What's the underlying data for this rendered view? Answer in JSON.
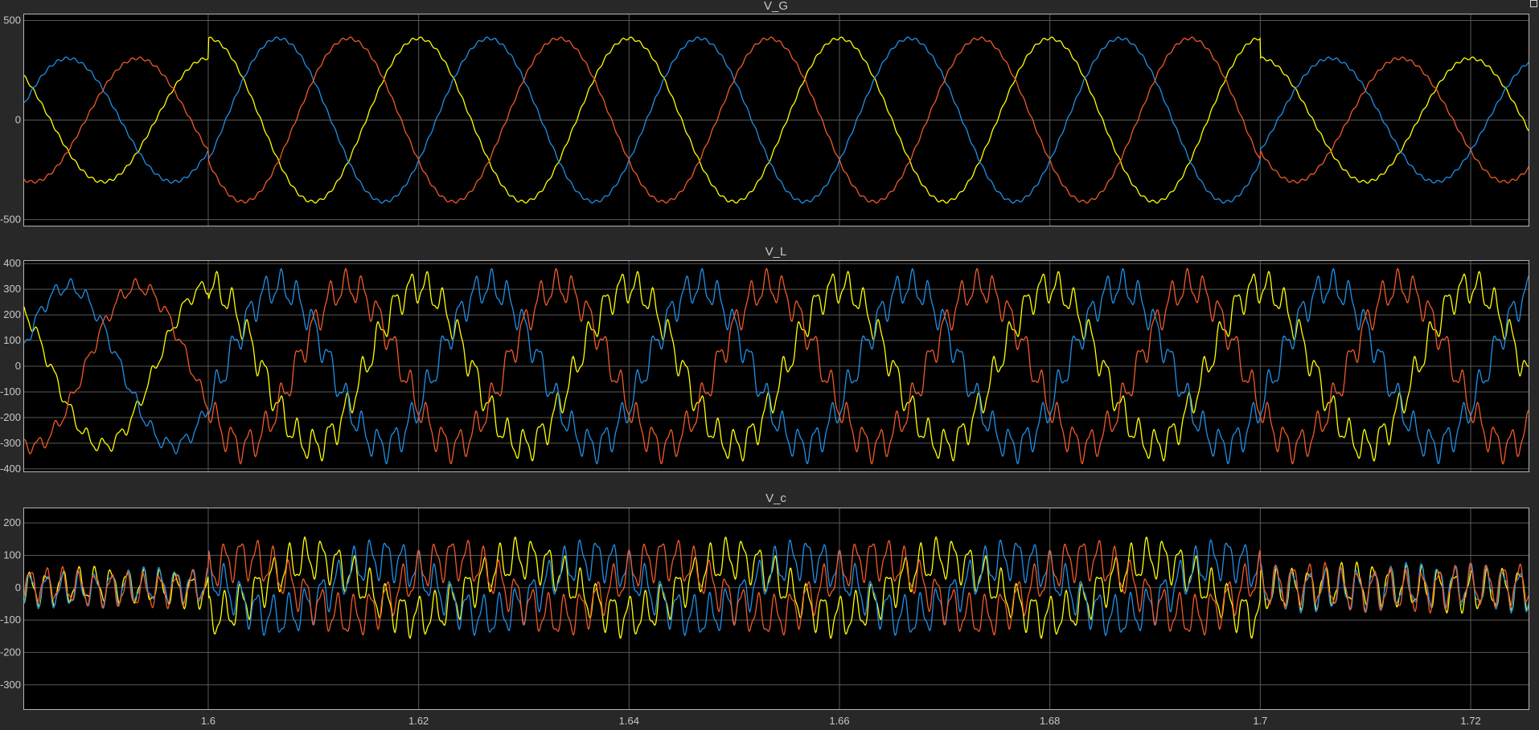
{
  "colors": {
    "background": "#282828",
    "axes": "#000000",
    "grid": "#585858",
    "text": "#c8c8c8",
    "phase_a": "#FFFF00",
    "phase_b": "#1E90E8",
    "phase_c": "#F05A28"
  },
  "chart_data": [
    {
      "type": "line",
      "title": "V_G",
      "xlim": [
        1.5825,
        1.7255
      ],
      "ylim": [
        -530,
        530
      ],
      "xticks": [
        "1.6",
        "1.62",
        "1.64",
        "1.66",
        "1.68",
        "1.7",
        "1.72"
      ],
      "yticks": [
        "500",
        "0",
        "-500"
      ],
      "grid": true,
      "frequency_hz": 50,
      "series": [
        {
          "color": "#FFFF00",
          "phase_deg": 90,
          "segments": [
            {
              "x": [
                1.5825,
                1.6
              ],
              "amplitude": 310
            },
            {
              "x": [
                1.6,
                1.7
              ],
              "amplitude": 410
            },
            {
              "x": [
                1.7,
                1.7255
              ],
              "amplitude": 310
            }
          ]
        },
        {
          "color": "#1E90E8",
          "phase_deg": -30,
          "segments": [
            {
              "x": [
                1.5825,
                1.6
              ],
              "amplitude": 310
            },
            {
              "x": [
                1.6,
                1.7
              ],
              "amplitude": 410
            },
            {
              "x": [
                1.7,
                1.7255
              ],
              "amplitude": 310
            }
          ]
        },
        {
          "color": "#F05A28",
          "phase_deg": 210,
          "segments": [
            {
              "x": [
                1.5825,
                1.6
              ],
              "amplitude": 310
            },
            {
              "x": [
                1.6,
                1.7
              ],
              "amplitude": 410
            },
            {
              "x": [
                1.7,
                1.7255
              ],
              "amplitude": 310
            }
          ]
        }
      ]
    },
    {
      "type": "line",
      "title": "V_L",
      "xlim": [
        1.5825,
        1.7255
      ],
      "ylim": [
        -410,
        410
      ],
      "xticks": [
        "1.6",
        "1.62",
        "1.64",
        "1.66",
        "1.68",
        "1.7",
        "1.72"
      ],
      "yticks": [
        "400",
        "300",
        "200",
        "100",
        "0",
        "-100",
        "-200",
        "-300",
        "-400"
      ],
      "grid": true,
      "frequency_hz": 50,
      "series": [
        {
          "color": "#FFFF00",
          "phase_deg": 90,
          "amplitude": 310,
          "ripple": [
            {
              "x": [
                1.5825,
                1.6
              ],
              "value": 25
            },
            {
              "x": [
                1.6,
                1.7
              ],
              "value": 55
            },
            {
              "x": [
                1.7,
                1.7255
              ],
              "value": 55
            }
          ]
        },
        {
          "color": "#1E90E8",
          "phase_deg": -30,
          "amplitude": 310,
          "ripple": [
            {
              "x": [
                1.5825,
                1.6
              ],
              "value": 25
            },
            {
              "x": [
                1.6,
                1.7
              ],
              "value": 55
            },
            {
              "x": [
                1.7,
                1.7255
              ],
              "value": 55
            }
          ]
        },
        {
          "color": "#F05A28",
          "phase_deg": 210,
          "amplitude": 310,
          "ripple": [
            {
              "x": [
                1.5825,
                1.6
              ],
              "value": 25
            },
            {
              "x": [
                1.6,
                1.7
              ],
              "value": 55
            },
            {
              "x": [
                1.7,
                1.7255
              ],
              "value": 55
            }
          ]
        }
      ]
    },
    {
      "type": "line",
      "title": "V_c",
      "xlim": [
        1.5825,
        1.7255
      ],
      "ylim": [
        -375,
        245
      ],
      "xticks": [
        "1.6",
        "1.62",
        "1.64",
        "1.66",
        "1.68",
        "1.7",
        "1.72"
      ],
      "yticks": [
        "200",
        "100",
        "0",
        "-100",
        "-200",
        "-300"
      ],
      "grid": true,
      "frequency_hz": 50,
      "series": [
        {
          "color": "#FFFF00",
          "phase_deg": 270,
          "segments": [
            {
              "x": [
                1.5825,
                1.6
              ],
              "amplitude": 10,
              "ripple": 45
            },
            {
              "x": [
                1.6,
                1.7
              ],
              "amplitude": 90,
              "ripple": 55
            },
            {
              "x": [
                1.7,
                1.7255
              ],
              "amplitude": 10,
              "ripple": 55
            }
          ]
        },
        {
          "color": "#1E90E8",
          "phase_deg": 150,
          "segments": [
            {
              "x": [
                1.5825,
                1.6
              ],
              "amplitude": 10,
              "ripple": 45
            },
            {
              "x": [
                1.6,
                1.7
              ],
              "amplitude": 90,
              "ripple": 55
            },
            {
              "x": [
                1.7,
                1.7255
              ],
              "amplitude": 10,
              "ripple": 55
            }
          ]
        },
        {
          "color": "#F05A28",
          "phase_deg": 30,
          "segments": [
            {
              "x": [
                1.5825,
                1.6
              ],
              "amplitude": 10,
              "ripple": 45
            },
            {
              "x": [
                1.6,
                1.7
              ],
              "amplitude": 90,
              "ripple": 55
            },
            {
              "x": [
                1.7,
                1.7255
              ],
              "amplitude": 10,
              "ripple": 55
            }
          ]
        }
      ]
    }
  ]
}
